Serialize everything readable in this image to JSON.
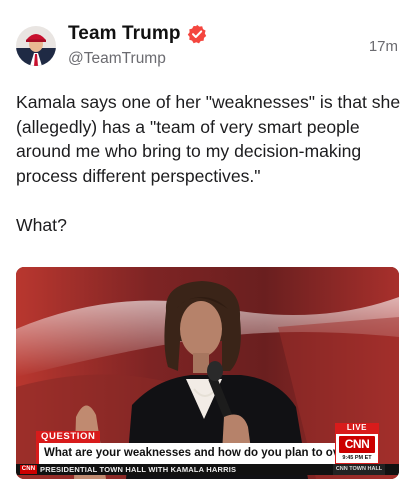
{
  "post": {
    "author": {
      "display_name": "Team Trump",
      "handle": "@TeamTrump",
      "verified_icon": "verified-badge-icon",
      "verified_color": "#f4463f"
    },
    "timestamp": "17m",
    "text": "Kamala says one of her \"weaknesses\" is that she (allegedly) has a \"team of very smart people around me who bring to my decision-making process different perspectives.\"\n\nWhat?",
    "media": {
      "broadcast": {
        "question_tag": "QUESTION",
        "question_text": "What are your weaknesses and how do you plan to overcome them?",
        "ticker_text": "PRESIDENTIAL TOWN HALL WITH KAMALA HARRIS",
        "ticker_logo": "CNN",
        "live_tag": "LIVE",
        "network_logo": "CNN",
        "time": "9:45 PM ET",
        "town_hall_tag": "CNN TOWN HALL"
      }
    }
  },
  "colors": {
    "accent_red": "#d81b1b",
    "name_text": "#111111",
    "secondary_text": "#6b6b70"
  }
}
